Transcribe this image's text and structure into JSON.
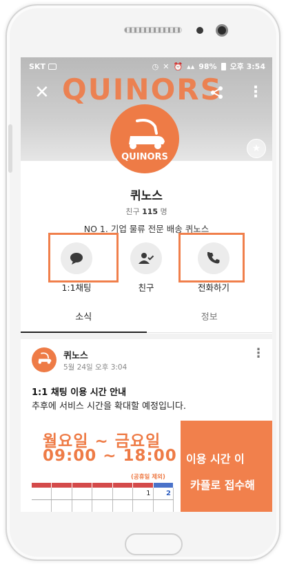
{
  "status_bar": {
    "carrier": "SKT",
    "battery": "98%",
    "time": "오후 3:54"
  },
  "profile": {
    "cover_text": "QUINORS",
    "logo_text": "QUINORS",
    "name": "퀴노스",
    "friends_label": "친구",
    "friends_count": "115",
    "friends_unit": "명",
    "description": "NO 1. 기업 물류 전문 배송 퀴노스"
  },
  "actions": [
    {
      "label": "1:1채팅",
      "icon": "chat-bubble-icon"
    },
    {
      "label": "친구",
      "icon": "person-check-icon"
    },
    {
      "label": "전화하기",
      "icon": "phone-icon"
    }
  ],
  "tabs": [
    {
      "label": "소식"
    },
    {
      "label": "정보"
    }
  ],
  "post": {
    "author": "퀴노스",
    "date": "5월 24일 오후 3:04",
    "title": "1:1 채팅 이용 시간 안내",
    "body": "추후에 서비스 시간을 확대할 예정입니다.",
    "banner": {
      "days": "월요일 ~ 금요일",
      "time": "09:00 ~ 18:00",
      "note": "(공휴일 제외)",
      "calendar_days": [
        "1",
        "2"
      ],
      "right_line1": "이용 시간 이",
      "right_line2": "카플로 접수해"
    }
  },
  "colors": {
    "brand": "#ee7b46",
    "highlight": "#f07f4b"
  }
}
